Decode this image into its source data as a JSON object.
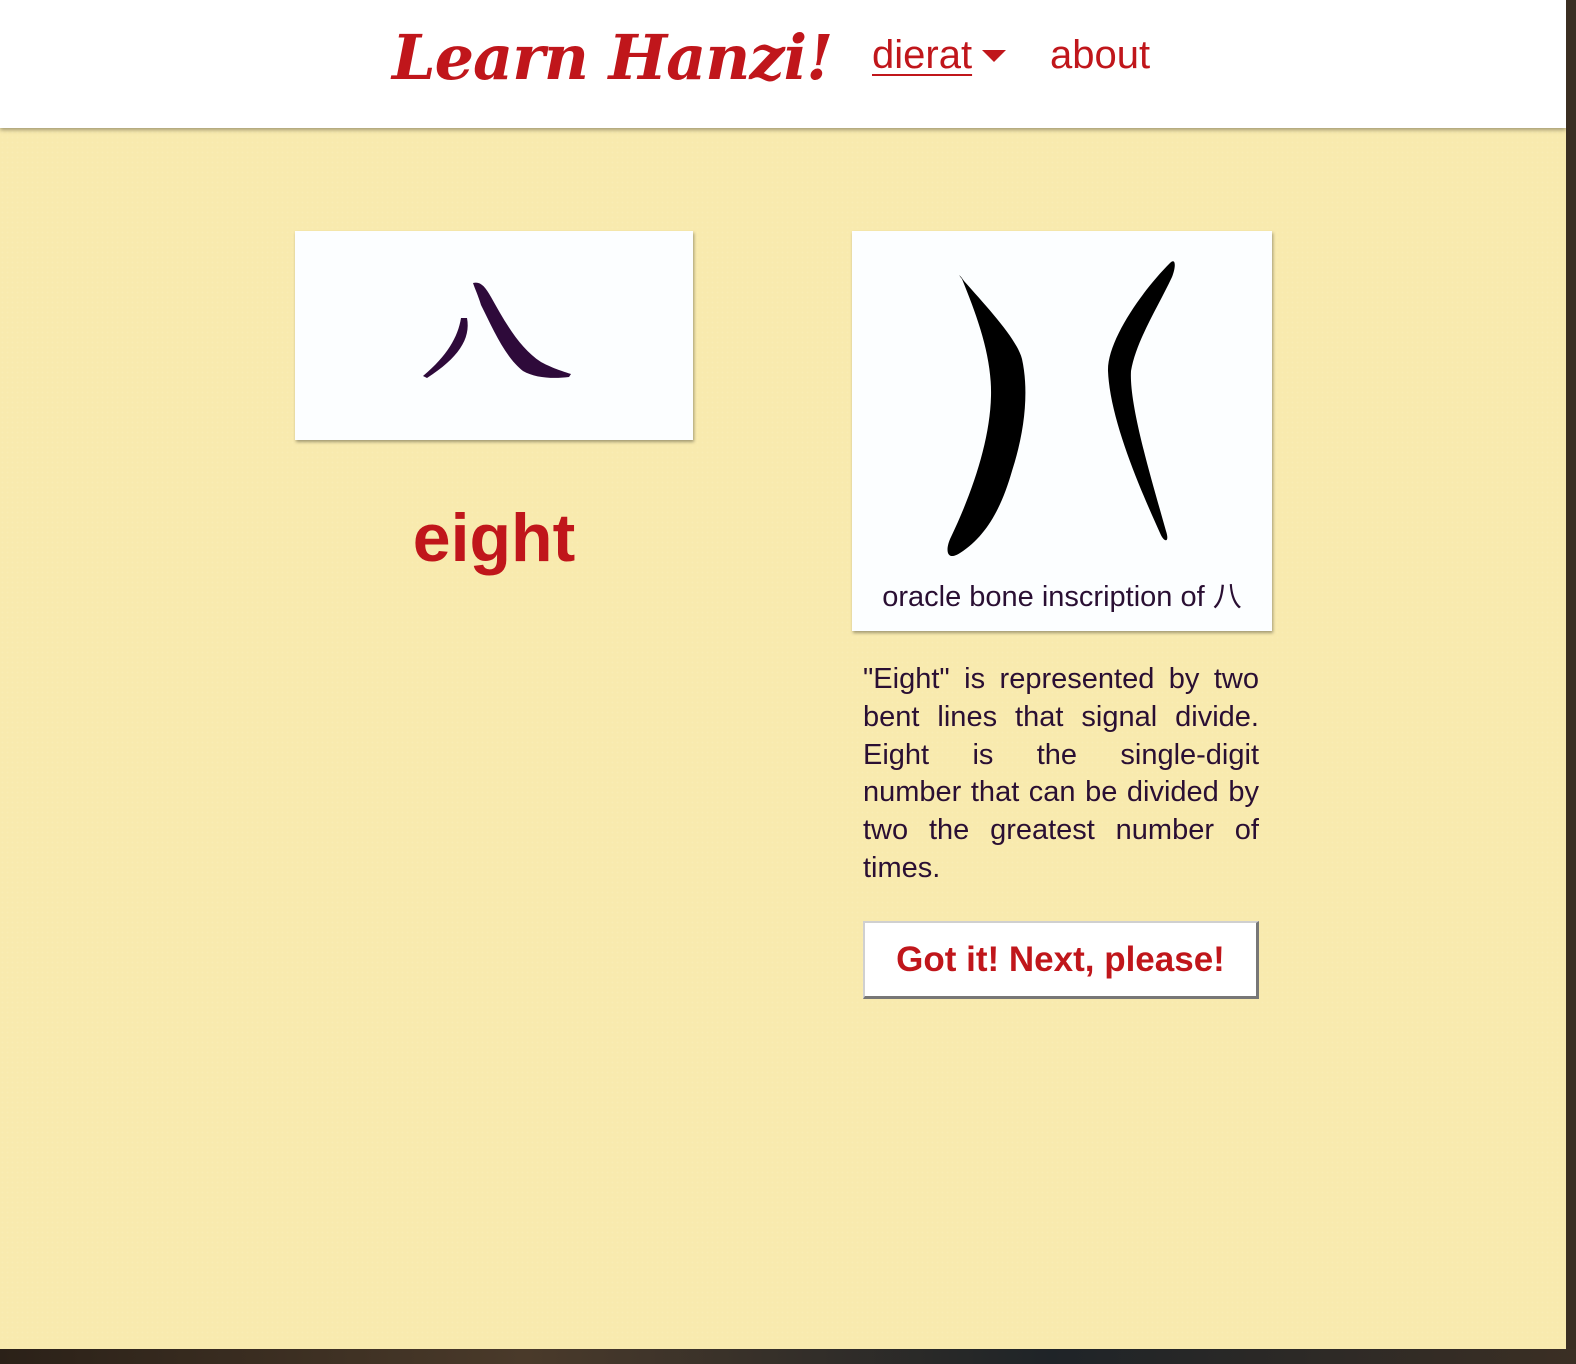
{
  "header": {
    "brand": "Learn Hanzi!",
    "nav": {
      "dierat_label": "dierat",
      "about_label": "about"
    }
  },
  "flashcard": {
    "hanzi": "八",
    "meaning": "eight"
  },
  "oracle": {
    "caption": "oracle bone inscription of 八"
  },
  "explanation": {
    "text": "\"Eight\" is represented by two bent lines that signal divide. Eight is the single-digit number that can be divided by two the greatest number of times."
  },
  "actions": {
    "next_label": "Got it! Next, please!"
  },
  "colors": {
    "accent": "#c0161b",
    "background": "#f8eaae",
    "text": "#2a0f33"
  }
}
